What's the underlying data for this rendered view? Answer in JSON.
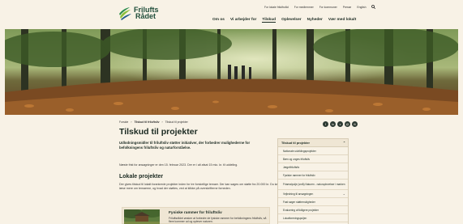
{
  "header": {
    "logo": {
      "line1": "Frilufts",
      "line2": "Rådet"
    },
    "utility_links": [
      "For lokale friluftsråd",
      "For medlemmer",
      "For kommuner",
      "Presse",
      "English"
    ],
    "nav": [
      "Om os",
      "Vi arbejder for",
      "Tilskud",
      "Oplevelser",
      "Nyheder",
      "Vær med lokalt"
    ],
    "active_nav": "Tilskud"
  },
  "breadcrumb": [
    "Forside",
    "Tilskud til friluftsliv",
    "Tilskud til projekter"
  ],
  "share_icons": [
    "f",
    "in",
    "x",
    "@",
    "✉"
  ],
  "page": {
    "title": "Tilskud til projekter",
    "lead": "Udlodningsmidler til friluftsliv støtter initiativer, der forbedrer mulighederne for befolkningens friluftsliv og naturforståelse.",
    "notice": "Næste frist for ansøgninger er den 15. februar 2023. Der er i alt afsat 15 mio. kr. til uddeling.",
    "section_heading": "Lokale projekter",
    "section_body": "Der gives tilskud til lokalt forankrede projekter inden for tre forskellige temaer. Der kan søges om støtte fra 20.000 kr. Du kan læse mere om temaerne, og hvad der støttes, ved at klikke på overskrifterne forneden."
  },
  "card": {
    "title": "Fysiske rammer for friluftsliv",
    "description": "Friluftsrådet ønsker at forbedre de fysiske rammer for befolkningens friluftsliv, så flere kommer ud og oplever naturen."
  },
  "sidebar": {
    "heading": "Tilskud til projekter",
    "items": [
      {
        "label": "Nationale udviklingsprojekter",
        "chevron": false
      },
      {
        "label": "Bæn og unges friluftsliv",
        "chevron": false
      },
      {
        "label": "Jægelfriluftsliv",
        "chevron": false
      },
      {
        "label": "Fysiske rammer for friluftsliv",
        "chevron": false
      },
      {
        "label": "Friarealpulje (små) Naturen - naturoplevelser i marken",
        "chevron": false
      },
      {
        "label": "Vejledning til ansøgningen",
        "chevron": true
      },
      {
        "label": "Fast søger støttemuligheder",
        "chevron": false
      },
      {
        "label": "Evaluering af tidligere projekter",
        "chevron": false
      },
      {
        "label": "Lokalforeningspuljen",
        "chevron": false
      }
    ]
  },
  "colors": {
    "background": "#f8f2e6",
    "accent_green": "#1f4d3a",
    "text": "#1b2a22"
  }
}
